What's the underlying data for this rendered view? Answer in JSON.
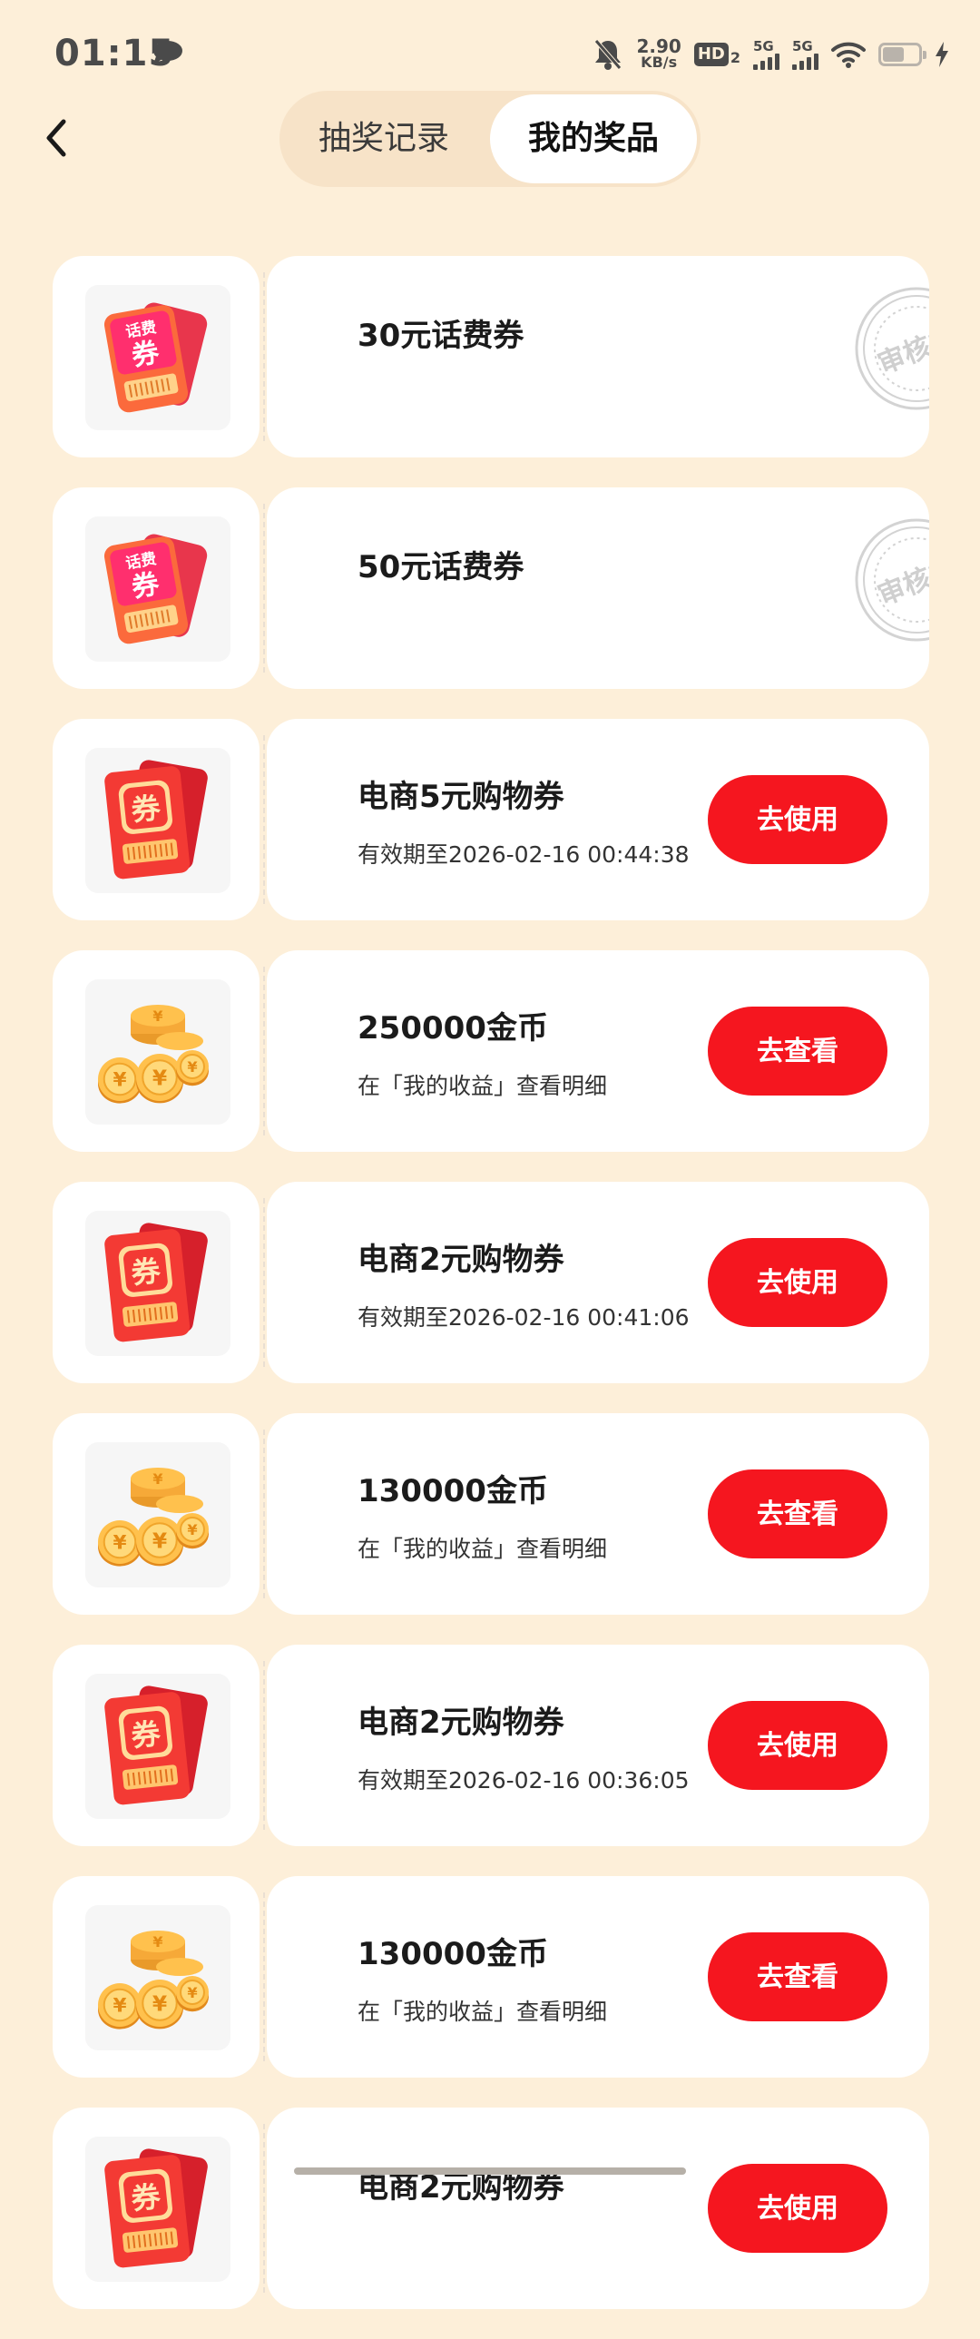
{
  "status_bar": {
    "time": "01:15",
    "net_speed": "2.90",
    "net_unit": "KB/s",
    "hd_label": "HD",
    "hd_sub": "2",
    "sim1_label": "5G",
    "sim2_label": "5G",
    "battery_level": 0.6
  },
  "header": {
    "tabs": [
      {
        "label": "抽奖记录",
        "active": false
      },
      {
        "label": "我的奖品",
        "active": true
      }
    ]
  },
  "prizes": [
    {
      "type": "phone-voucher",
      "title": "30元话费券",
      "subtitle": "",
      "action": "",
      "stamp": "审核中"
    },
    {
      "type": "phone-voucher",
      "title": "50元话费券",
      "subtitle": "",
      "action": "",
      "stamp": "审核中"
    },
    {
      "type": "shopping-voucher",
      "title": "电商5元购物券",
      "subtitle": "有效期至2026-02-16 00:44:38",
      "action": "去使用"
    },
    {
      "type": "coins",
      "title": "250000金币",
      "subtitle": "在「我的收益」查看明细",
      "action": "去查看"
    },
    {
      "type": "shopping-voucher",
      "title": "电商2元购物券",
      "subtitle": "有效期至2026-02-16 00:41:06",
      "action": "去使用"
    },
    {
      "type": "coins",
      "title": "130000金币",
      "subtitle": "在「我的收益」查看明细",
      "action": "去查看"
    },
    {
      "type": "shopping-voucher",
      "title": "电商2元购物券",
      "subtitle": "有效期至2026-02-16 00:36:05",
      "action": "去使用"
    },
    {
      "type": "coins",
      "title": "130000金币",
      "subtitle": "在「我的收益」查看明细",
      "action": "去查看"
    },
    {
      "type": "shopping-voucher",
      "title": "电商2元购物券",
      "subtitle": "",
      "action": "去使用"
    }
  ],
  "icons": {
    "phone_voucher_text_top": "话费",
    "phone_voucher_text_main": "券",
    "shopping_voucher_text": "券",
    "coin_symbol": "¥"
  },
  "colors": {
    "page_bg": "#fdefd9",
    "accent_red": "#f5161f",
    "stamp_gray": "#d0d0d0"
  }
}
